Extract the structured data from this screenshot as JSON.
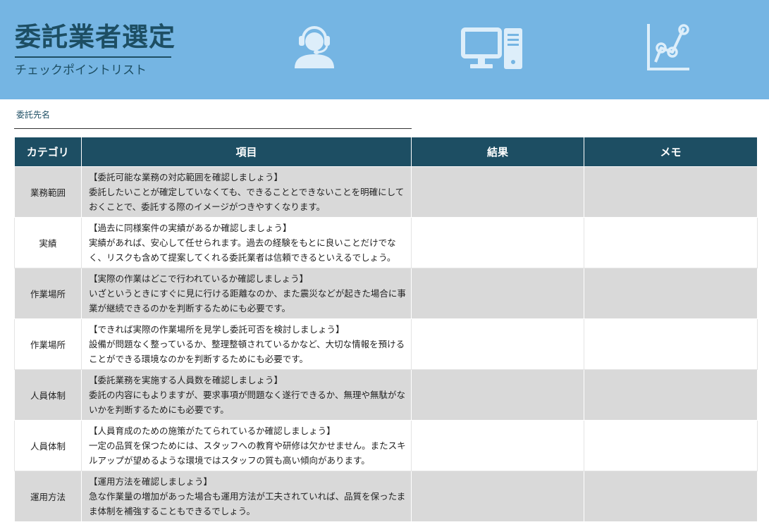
{
  "header": {
    "title": "委託業者選定",
    "subtitle": "チェックポイントリスト",
    "icons": [
      "operator-icon",
      "desktop-computer-icon",
      "line-chart-icon"
    ],
    "colors": {
      "banner": "#75b5e3",
      "title": "#1d4e63",
      "icon": "#ddeefa"
    }
  },
  "client": {
    "label": "委託先名",
    "value": ""
  },
  "table": {
    "columns": [
      "カテゴリ",
      "項目",
      "結果",
      "メモ"
    ],
    "header_color": "#1d4e63",
    "shade_color": "#d9d9d9",
    "rows": [
      {
        "category": "業務範囲",
        "title": "【委託可能な業務の対応範囲を確認しましょう】",
        "desc": "委託したいことが確定していなくても、できることとできないことを明確にしておくことで、委託する際のイメージがつきやすくなります。",
        "result": "",
        "memo": ""
      },
      {
        "category": "実績",
        "title": "【過去に同様案件の実績があるか確認しましょう】",
        "desc": "実績があれば、安心して任せられます。過去の経験をもとに良いことだけでなく、リスクも含めて提案してくれる委託業者は信頼できるといえるでしょう。",
        "result": "",
        "memo": ""
      },
      {
        "category": "作業場所",
        "title": "【実際の作業はどこで行われているか確認しましょう】",
        "desc": "いざというときにすぐに見に行ける距離なのか、また震災などが起きた場合に事業が継続できるのかを判断するためにも必要です。",
        "result": "",
        "memo": ""
      },
      {
        "category": "作業場所",
        "title": "【できれば実際の作業場所を見学し委託可否を検討しましょう】",
        "desc": "設備が問題なく整っているか、整理整頓されているかなど、大切な情報を預けることができる環境なのかを判断するためにも必要です。",
        "result": "",
        "memo": ""
      },
      {
        "category": "人員体制",
        "title": "【委託業務を実施する人員数を確認しましょう】",
        "desc": "委託の内容にもよりますが、要求事項が問題なく遂行できるか、無理や無駄がないかを判断するためにも必要です。",
        "result": "",
        "memo": ""
      },
      {
        "category": "人員体制",
        "title": "【人員育成のための施策がたてられているか確認しましょう】",
        "desc": "一定の品質を保つためには、スタッフへの教育や研修は欠かせません。またスキルアップが望めるような環境ではスタッフの質も高い傾向があります。",
        "result": "",
        "memo": ""
      },
      {
        "category": "運用方法",
        "title": "【運用方法を確認しましょう】",
        "desc": "急な作業量の増加があった場合も運用方法が工夫されていれば、品質を保ったまま体制を補強することもできるでしょう。",
        "result": "",
        "memo": ""
      }
    ]
  }
}
